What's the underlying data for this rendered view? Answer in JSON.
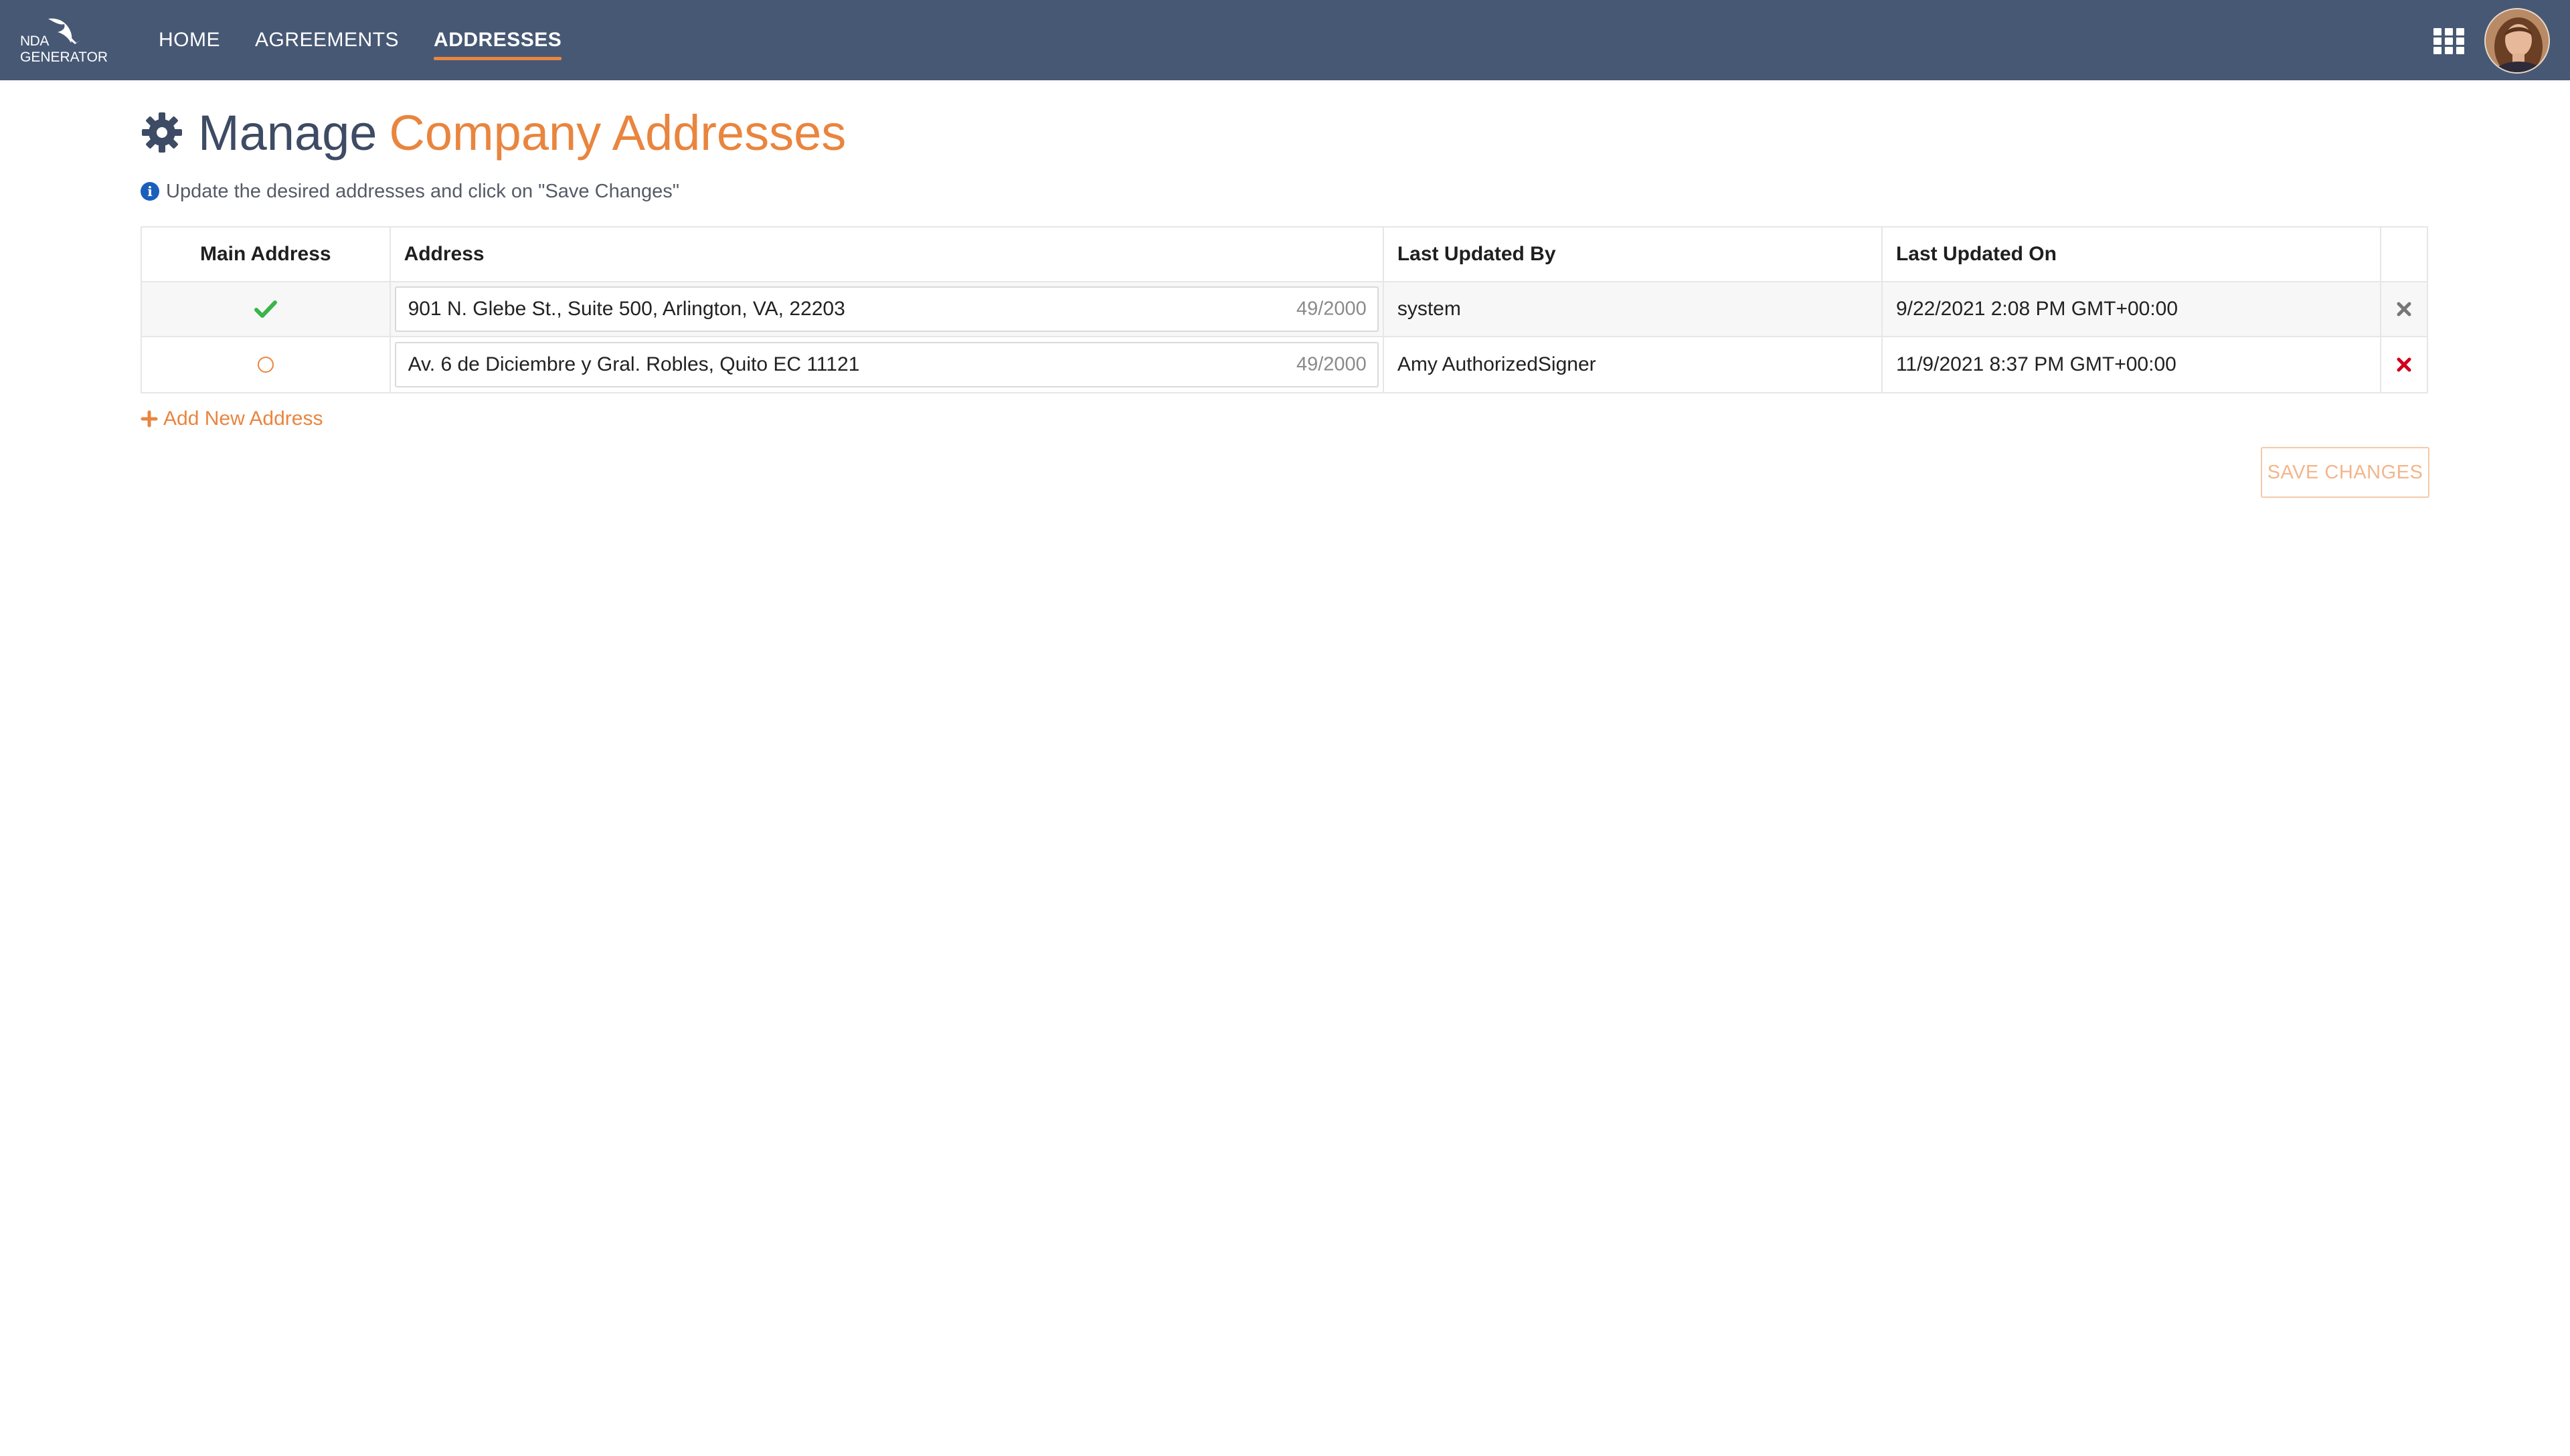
{
  "brand": {
    "logo_line1": "NDA",
    "logo_line2": "GENERATOR"
  },
  "nav": {
    "items": [
      {
        "label": "HOME",
        "active": false
      },
      {
        "label": "AGREEMENTS",
        "active": false
      },
      {
        "label": "ADDRESSES",
        "active": true
      }
    ]
  },
  "header_icons": {
    "apps": "apps-grid-icon",
    "avatar": "user-avatar"
  },
  "page": {
    "title_main": "Manage",
    "title_accent": "Company Addresses",
    "title_icon": "gear-icon",
    "info_text": "Update the desired addresses and click on \"Save Changes\""
  },
  "table": {
    "columns": [
      "Main Address",
      "Address",
      "Last Updated By",
      "Last Updated On",
      ""
    ],
    "rows": [
      {
        "is_main": true,
        "address": "901 N. Glebe St., Suite 500, Arlington, VA, 22203",
        "char_count": "49/2000",
        "updated_by": "system",
        "updated_on": "9/22/2021 2:08 PM GMT+00:00",
        "delete_color": "#777777"
      },
      {
        "is_main": false,
        "address": "Av. 6 de Diciembre y Gral. Robles, Quito EC 11121",
        "char_count": "49/2000",
        "updated_by": "Amy AuthorizedSigner",
        "updated_on": "11/9/2021 8:37 PM GMT+00:00",
        "delete_color": "#d0021b"
      }
    ]
  },
  "actions": {
    "add_new": "Add New Address",
    "save": "SAVE CHANGES"
  },
  "colors": {
    "topbar": "#475874",
    "accent": "#e9853e",
    "title": "#3d4b64",
    "check": "#3bb54a",
    "info": "#1b5fbd"
  }
}
